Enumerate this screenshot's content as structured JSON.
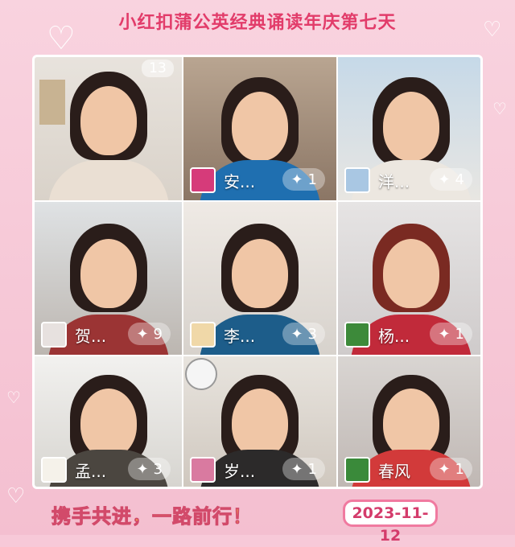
{
  "title": "小红扣蒲公英经典诵读年庆第七天",
  "participant_count": "13",
  "tiles": [
    {
      "name": "",
      "badge": ""
    },
    {
      "name": "安...",
      "badge": "1"
    },
    {
      "name": "洋...",
      "badge": "4"
    },
    {
      "name": "贺...",
      "badge": "9"
    },
    {
      "name": "李...",
      "badge": "3"
    },
    {
      "name": "杨...",
      "badge": "1"
    },
    {
      "name": "孟...",
      "badge": "3"
    },
    {
      "name": "岁...",
      "badge": "1"
    },
    {
      "name": "春风",
      "badge": "1"
    }
  ],
  "slogan": "携手共进，一路前行！",
  "date": "2023-11-12",
  "colors": {
    "title": "#e23c6a",
    "background": "#f7c9d8",
    "slogan": "#ffcd3a"
  }
}
